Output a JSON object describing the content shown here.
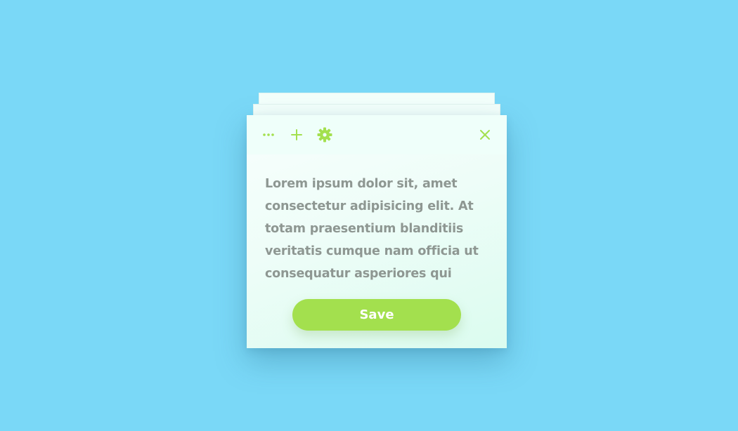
{
  "note": {
    "text": "Lorem ipsum dolor sit, amet consectetur adipisicing elit. At totam praesentium blanditiis veritatis cumque nam officia ut consequatur asperiores qui",
    "save_label": "Save"
  },
  "toolbar": {
    "icons": {
      "more": "more-horizontal-icon",
      "add": "plus-icon",
      "settings": "gear-icon",
      "close": "close-icon"
    }
  },
  "colors": {
    "background": "#7ad8f7",
    "accent": "#a3e04e",
    "card": "#f3fffb",
    "text": "#8e9792"
  }
}
